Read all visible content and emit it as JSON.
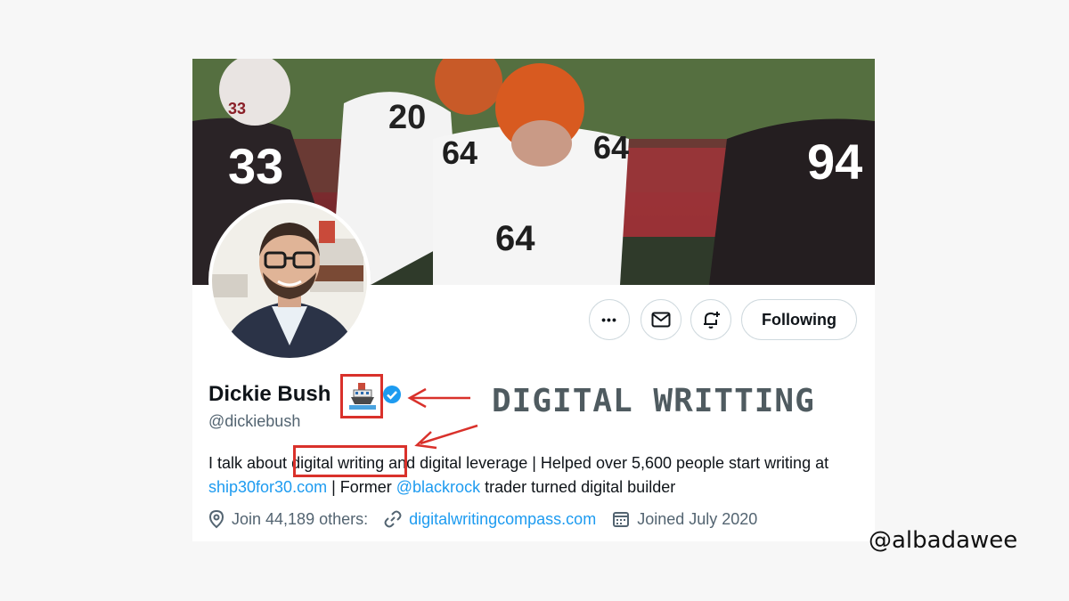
{
  "profile": {
    "display_name": "Dickie Bush",
    "handle": "@dickiebush",
    "bio": {
      "part1": "I talk about ",
      "highlight": "digital writing",
      "part2": " and digital leverage | Helped over 5,600 people start writing at ",
      "link1": "ship30for30.com",
      "part3": " | Former ",
      "link2": "@blackrock",
      "part4": " trader turned digital builder"
    },
    "meta": {
      "location": "Join 44,189 others:",
      "website": "digitalwritingcompass.com",
      "joined": "Joined July 2020"
    }
  },
  "actions": {
    "more": "•••",
    "following": "Following"
  },
  "banner": {
    "jersey_numbers": [
      "33",
      "20",
      "64",
      "64",
      "94",
      "33",
      "64"
    ]
  },
  "annotation": {
    "label": "DIGITAL WRITTING"
  },
  "watermark": "@albadawee",
  "colors": {
    "highlight_red": "#d9312b",
    "link_blue": "#1d9bf0",
    "verified_blue": "#1d9bf0"
  }
}
